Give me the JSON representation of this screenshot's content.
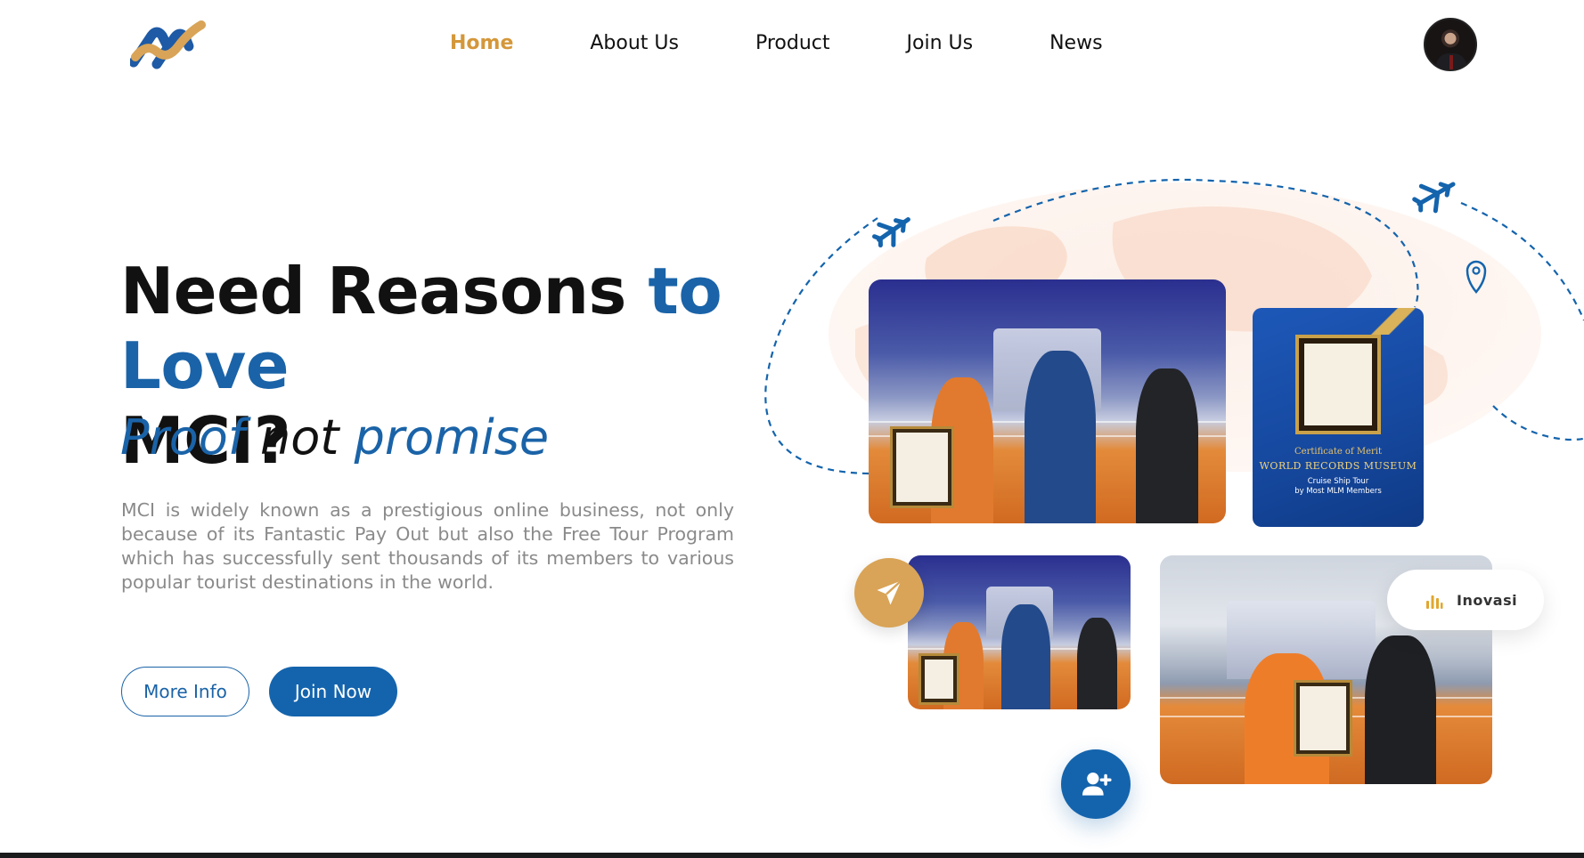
{
  "nav": {
    "items": [
      {
        "label": "Home",
        "active": true
      },
      {
        "label": "About Us",
        "active": false
      },
      {
        "label": "Product",
        "active": false
      },
      {
        "label": "Join Us",
        "active": false
      },
      {
        "label": "News",
        "active": false
      }
    ]
  },
  "hero": {
    "headline_part1": "Need Reasons ",
    "headline_part2": "to Love",
    "headline_part3": "MCI?",
    "subhead_part1": "Proof",
    "subhead_part2": "not",
    "subhead_part3": "promise",
    "description": "MCI is widely known as a prestigious online business, not only because of its Fantastic Pay Out but also the Free Tour Program which has successfully sent thousands of its members to various popular tourist destinations in the world.",
    "more_info_label": "More Info",
    "join_now_label": "Join Now"
  },
  "certificate": {
    "line1": "Certificate of Merit",
    "line2": "WORLD RECORDS MUSEUM",
    "line3": "Cruise Ship Tour",
    "line4": "by Most MLM Members"
  },
  "badge": {
    "label": "Inovasi",
    "icon": "bar-chart-icon"
  },
  "icons": {
    "logo": "mci-logo",
    "plane": "paper-plane-icon",
    "user": "add-user-icon",
    "pin": "location-pin-icon"
  },
  "colors": {
    "primary_blue": "#1464ad",
    "accent_gold": "#d4973a",
    "text_dark": "#111111",
    "text_muted": "#8a8a8a"
  }
}
